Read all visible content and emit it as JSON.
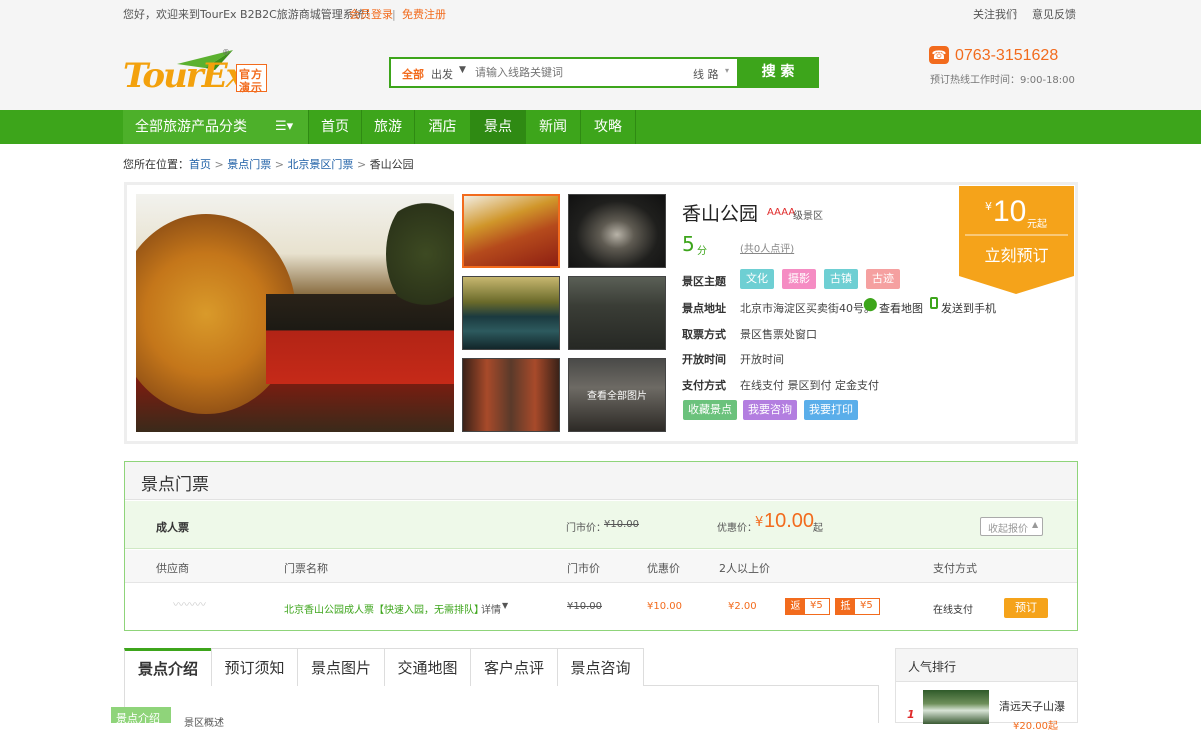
{
  "topbar": {
    "welcome": "您好，欢迎来到TourEx B2B2C旅游商城管理系统！",
    "login": "会员登录",
    "register": "免费注册",
    "follow": "关注我们",
    "feedback": "意见反馈",
    "sep": "|"
  },
  "logo": {
    "text": "TourEx",
    "badge1": "官方",
    "badge2": "演示",
    "reg": "®"
  },
  "search": {
    "scope_all": "全部",
    "scope_depart": "出发",
    "placeholder": "请输入线路关键词",
    "type": "线 路",
    "button": "搜 索"
  },
  "hotline": {
    "phone": "0763-3151628",
    "hours": "预订热线工作时间：9:00-18:00"
  },
  "nav": {
    "all_categories": "全部旅游产品分类",
    "items": [
      "首页",
      "旅游",
      "酒店",
      "景点",
      "新闻",
      "攻略"
    ]
  },
  "breadcrumb": {
    "prefix": "您所在位置：",
    "items": [
      "首页",
      "景点门票",
      "北京景区门票",
      "香山公园"
    ],
    "arrow": ">"
  },
  "attraction": {
    "name": "香山公园",
    "level": "AAAA",
    "level_suffix": "级景区",
    "score": "5",
    "score_unit": "分",
    "reviews": "(共0人点评)",
    "theme_label": "景区主题",
    "themes": [
      "文化",
      "摄影",
      "古镇",
      "古迹"
    ],
    "address_label": "景点地址",
    "address": "北京市海淀区买卖街40号。",
    "map_link": "查看地图",
    "phone_link": "发送到手机",
    "pickup_label": "取票方式",
    "pickup": "景区售票处窗口",
    "hours_label": "开放时间",
    "hours": "开放时间",
    "payment_label": "支付方式",
    "payment": "在线支付 景区到付 定金支付",
    "actions": [
      "收藏景点",
      "我要咨询",
      "我要打印"
    ],
    "view_all": "查看全部图片",
    "price_currency": "¥",
    "price": "10",
    "price_suffix": "元起",
    "book": "立刻预订"
  },
  "tickets": {
    "title": "景点门票",
    "group": {
      "name": "成人票",
      "market_label": "门市价：",
      "market_price": "¥10.00",
      "sale_label": "优惠价：",
      "sale_currency": "¥",
      "sale_price": "10.00",
      "sale_suffix": "起",
      "collapse": "收起报价"
    },
    "headers": [
      "供应商",
      "门票名称",
      "门市价",
      "优惠价",
      "2人以上价",
      "支付方式"
    ],
    "row": {
      "supplier": "〰〰〰",
      "name": "北京香山公园成人票【快速入园，无需排队】",
      "detail": "详情",
      "market": "¥10.00",
      "sale": "¥10.00",
      "group": "¥2.00",
      "rebate_label": "返",
      "rebate": "¥5",
      "deduct_label": "抵",
      "deduct": "¥5",
      "payment": "在线支付",
      "book": "预订"
    }
  },
  "tabs": [
    "景点介绍",
    "预订须知",
    "景点图片",
    "交通地图",
    "客户点评",
    "景点咨询"
  ],
  "sidebar": {
    "title": "人气排行",
    "rank": "1",
    "item_name": "清远天子山瀑",
    "item_price": "¥20.00起"
  },
  "bottom": {
    "float_label": "景点介绍",
    "overview": "景区概述"
  },
  "colors": {
    "brand_green": "#3da51b",
    "accent_orange": "#f26b1d",
    "price_orange": "#f5a31a"
  }
}
